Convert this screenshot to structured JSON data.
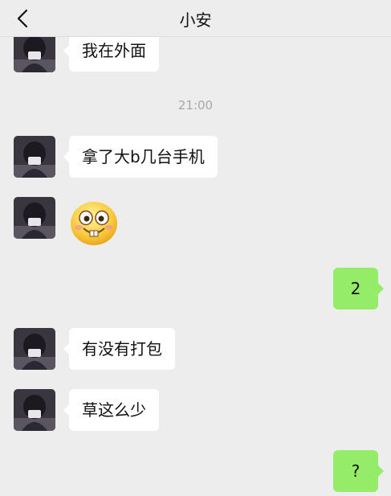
{
  "header": {
    "title": "小安",
    "back_icon": "chevron-left-icon"
  },
  "messages": [
    {
      "side": "in",
      "text": "我在外面"
    },
    {
      "timestamp": "21:00"
    },
    {
      "side": "in",
      "text": "拿了大b几台手机"
    },
    {
      "side": "in",
      "sticker": "grinning-face-emoji"
    },
    {
      "side": "out",
      "text": "2"
    },
    {
      "side": "in",
      "text": "有没有打包"
    },
    {
      "side": "in",
      "text": "草这么少"
    },
    {
      "side": "out",
      "text": "?"
    }
  ],
  "colors": {
    "incoming_bubble": "#ffffff",
    "outgoing_bubble": "#95ec69",
    "background": "#ededed"
  }
}
